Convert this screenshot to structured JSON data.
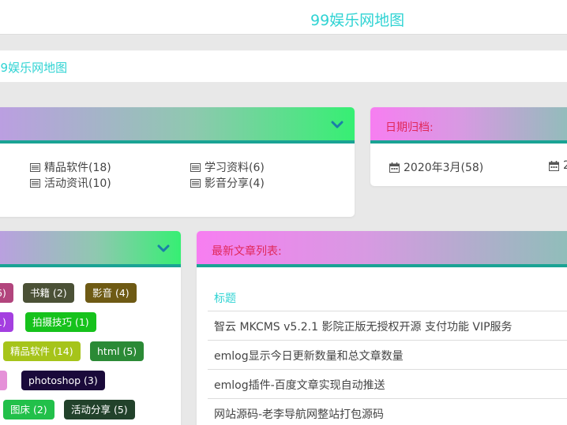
{
  "header": {
    "site_title": "99娱乐网地图"
  },
  "breadcrumb": {
    "current": "99娱乐网地图"
  },
  "categories": {
    "items": [
      {
        "label": "精品软件(18)",
        "icon": "list-icon"
      },
      {
        "label": "学习资料(6)",
        "icon": "list-icon"
      },
      {
        "label": "活动资讯(10)",
        "icon": "list-icon"
      },
      {
        "label": "影音分享(4)",
        "icon": "list-icon"
      }
    ]
  },
  "archive": {
    "title": "日期归档:",
    "items": [
      {
        "label": "2020年3月(58)",
        "icon": "calendar-icon"
      },
      {
        "label": "2",
        "icon": "calendar-icon"
      }
    ]
  },
  "tags": {
    "items": [
      {
        "label": "6)",
        "color": "#b2457d"
      },
      {
        "label": "书籍 (2)",
        "color": "#4b5136"
      },
      {
        "label": "影音 (4)",
        "color": "#6e5a14"
      },
      {
        "label": "1)",
        "color": "#a43fe0"
      },
      {
        "label": "拍摄技巧 (1)",
        "color": "#16c21c"
      },
      {
        "label": "精品软件 (14)",
        "color": "#a6c41a"
      },
      {
        "label": "html (5)",
        "color": "#2b8a36"
      },
      {
        "label": "",
        "color": "#e591d8"
      },
      {
        "label": "photoshop (3)",
        "color": "#1a0a3a"
      },
      {
        "label": "图床 (2)",
        "color": "#22c04a"
      },
      {
        "label": "活动分享 (5)",
        "color": "#22422b"
      }
    ]
  },
  "latest": {
    "title": "最新文章列表:",
    "column_header": "标题",
    "rows": [
      "智云 MKCMS v5.2.1 影院正版无授权开源 支付功能 VIP服务",
      "emlog显示今日更新数量和总文章数量",
      "emlog插件-百度文章实现自动推送",
      "网站源码-老李导航网整站打包源码"
    ]
  },
  "colors": {
    "accent": "#2fd3d3",
    "title_red": "#e0285a",
    "head_border": "#1aa394"
  }
}
